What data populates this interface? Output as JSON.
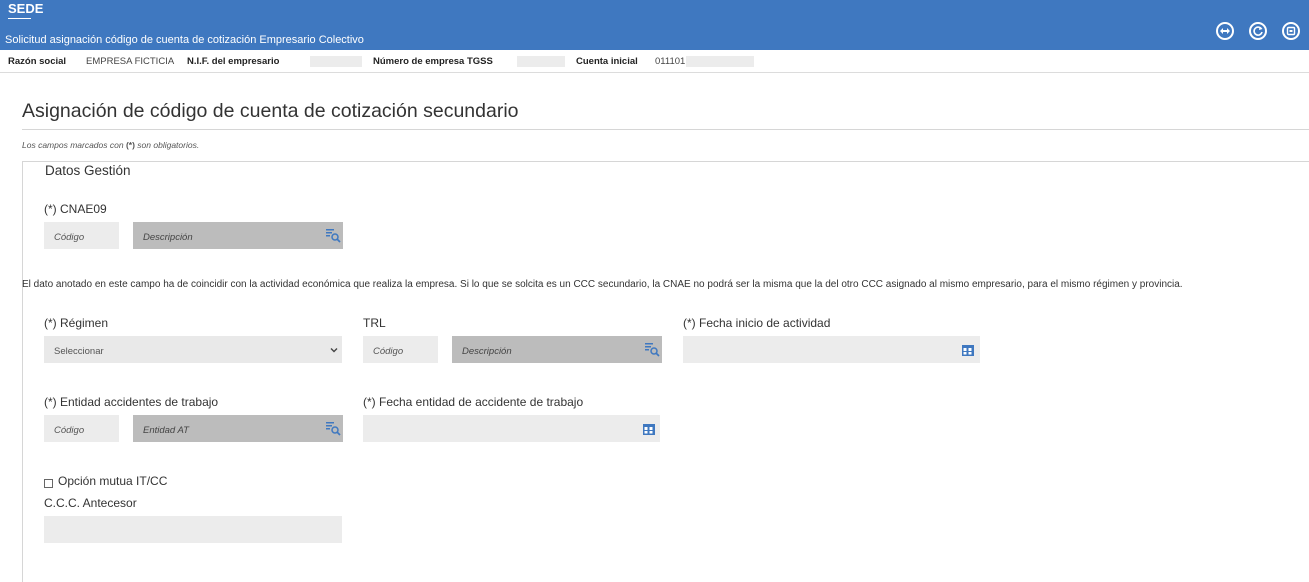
{
  "header": {
    "brand": "SEDE",
    "subtitle": "Solicitud asignación código de cuenta de cotización Empresario Colectivo",
    "buttons": [
      "navigate-icon",
      "refresh-icon",
      "exit-icon"
    ]
  },
  "info": {
    "razon_label": "Razón social",
    "razon_value": "EMPRESA FICTICIA",
    "nif_label": "N.I.F. del empresario",
    "numero_label": "Número de empresa TGSS",
    "cuenta_label": "Cuenta inicial",
    "cuenta_value": "011101"
  },
  "page_title": "Asignación de código de cuenta de cotización secundario",
  "note": {
    "prefix": "Los campos marcados con ",
    "mark": "(*)",
    "suffix": " son obligatorios."
  },
  "group_title": "Datos Gestión",
  "cnae": {
    "label": "(*) CNAE09",
    "codigo": "Código",
    "descripcion": "Descripción"
  },
  "help_text": "El dato anotado en este campo ha de coincidir con la actividad económica que realiza la empresa. Si lo que se solcita es un CCC secundario, la CNAE no podrá ser la misma que la del otro CCC asignado al mismo empresario, para el mismo régimen y provincia.",
  "regimen": {
    "label": "(*) Régimen",
    "value": "Seleccionar"
  },
  "trl": {
    "label": "TRL",
    "codigo": "Código",
    "descripcion": "Descripción"
  },
  "fecha_inicio": {
    "label": "(*) Fecha inicio de actividad"
  },
  "entidad": {
    "label": "(*) Entidad accidentes de trabajo",
    "codigo": "Código",
    "entidad_at": "Entidad AT"
  },
  "fecha_entidad": {
    "label": "(*) Fecha entidad de accidente de trabajo"
  },
  "opcion_mutua": {
    "label": "Opción mutua IT/CC",
    "checked": false
  },
  "ccc_antecesor": {
    "label": "C.C.C. Antecesor",
    "value": ""
  },
  "colors": {
    "header": "#3f78c0",
    "field": "#e9e9e9",
    "field_dark": "#bcbcbc"
  }
}
